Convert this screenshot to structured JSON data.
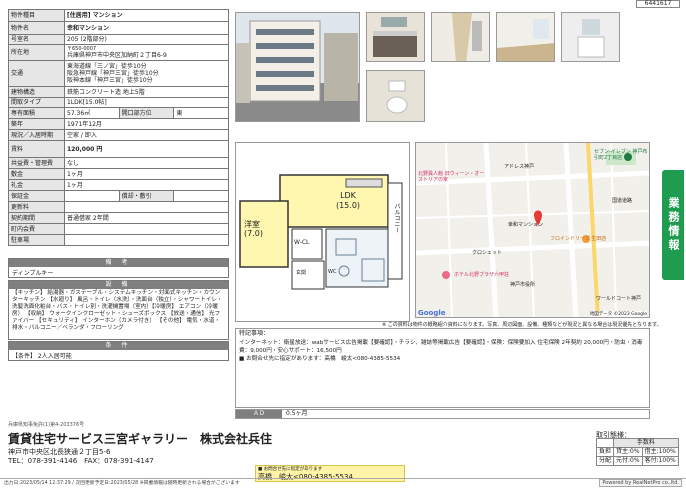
{
  "listing_code": "6441617",
  "spec": {
    "type_label": "物件種目",
    "type_value": "[住居用] マンション",
    "name_label": "物件名",
    "name_value": "幸和マンション",
    "room_label": "号室名",
    "room_value": "205 (2階部分)",
    "addr_label": "所在地",
    "zip": "〒650-0007",
    "addr_value": "兵庫県神戸市中央区加納町２丁目6-9",
    "access_label": "交通",
    "access": [
      "東海道線「三ノ宮」徒歩10分",
      "阪急神戸線「神戸三宮」徒歩10分",
      "阪神本線「神戸三宮」徒歩10分"
    ],
    "struct_label": "建物構造",
    "struct_value": "鉄筋コンクリート造 地上5階",
    "layout_label": "間取タイプ",
    "layout_value": "1LDK[15.0帖]",
    "area_label": "専有面積",
    "area_value": "57.36㎡",
    "bay_label": "開口部方位",
    "bay_value": "東",
    "age_label": "築年",
    "age_value": "1971年12月",
    "status_label": "現況／入居時期",
    "status_value": "空家 / 即入",
    "rent_label": "賃料",
    "rent_value": "120,000 円",
    "mgmt_label": "共益費・管理費",
    "mgmt_value": "なし",
    "deposit_label": "敷金",
    "deposit_value": "1ヶ月",
    "key_label": "礼金",
    "key_value": "1ヶ月",
    "guar_label": "保証金",
    "guar_value": "",
    "shikibiki_label": "償却・敷引",
    "shikibiki_value": "",
    "renew_label": "更新料",
    "renew_value": "",
    "contract_label": "契約期間",
    "contract_value": "普通借家 2年間",
    "fee_label": "町内会費",
    "fee_value": "",
    "parking_label": "駐車場",
    "parking_value": ""
  },
  "remarks_header": "備 考",
  "remarks_text": "ディンプルキー",
  "facilities_header": "設 備",
  "facilities_text": "【キッチン】 給湯器・ガステーブル・システムキッチン・対面式キッチン・カウンターキッチン 【水廻り】 風呂・トイレ（水洗）・洗面台（独立）・シャワートイレ・洗髪洗面化粧台・バス・トイレ別・洗濯機置場（室内）【冷暖房】 エアコン（冷暖房） 【収納】 ウォークインクローゼット・シューズボックス 【放送・通信】 光ファイバー 【セキュリティ】 インターホン（カメラ付き） 【その他】 電気・水道・排水・バルコニー／ベランダ・フローリング",
  "conditions_header": "条 件",
  "conditions_text": "【条件】 2人入居可能",
  "floorplan": {
    "ldk": "LDK",
    "ldk_size": "(15.0)",
    "western": "洋室",
    "western_size": "(7.0)",
    "wcl": "W-CL",
    "balcony": "バルコニー",
    "entrance": "玄関",
    "wc": "WC"
  },
  "map": {
    "labels": [
      "セブン-イレブン 神戸布引町2丁目店",
      "アドレス神戸",
      "ホテル北野プラザ六甲荘",
      "北野異人館 旧ウィーン・オーストリアの家",
      "フロインドリーブ 生田店",
      "幸和マンション",
      "国道道路",
      "クロシェット",
      "神戸市役所",
      "ワールドコート神戸"
    ],
    "google": "Google",
    "attribution": "地図データ ©2023 Google"
  },
  "map_note": "※ この資料は物件の概略紹介資料になります。写真、周辺図面、設備、種類などが現況と異なる場合は現況優先となります。",
  "special": {
    "title": "特記事項：",
    "lines": [
      "インターネット：衛星放送：wabサービス広告掲載【要確認】・チラシ、雑誌等掲載広告【要確認】・保険：保険要加入 住宅保険 2年契約 20,000円・防虫・消毒費：9,000円・安心サポート：16,500円",
      "■ お問合せ先に指定があります：高橋　峻太<080-4385-5534"
    ]
  },
  "ad_label": "ＡＤ",
  "ad_value": "0.5ヶ月",
  "license": "兵庫県知事免許(1)第4-203376号",
  "company": "賃貸住宅サービス三宮ギャラリー　株式会社兵住",
  "company_addr": "神戸市中央区北長狭通２丁目5-6",
  "company_tel": "TEL：078-391-4146　FAX：078-391-4147",
  "contact_note": "■ お問合せ先に指定があります",
  "contact": "高橋　峻太<080-4385-5534",
  "fee_table": {
    "title": "取引態様：",
    "header": "手数料",
    "r1a": "負担",
    "r1b": "貸主:0%",
    "r1c": "借主:100%",
    "r2a": "分配",
    "r2b": "元付:0%",
    "r2c": "客付:100%"
  },
  "footer_left": "出力日:2023/05/14 12:37:29 / 次回更新予定日:2023/05/28 ※掲載情報は随時更新される場合がございます",
  "footer_right": "Powered by RealNetPro co.,ltd.",
  "side_tab": "業務情報",
  "colors": {
    "accent": "#1f9c50",
    "header_gray": "#7f7f7f",
    "plan_yellow": "#fff7b0"
  }
}
